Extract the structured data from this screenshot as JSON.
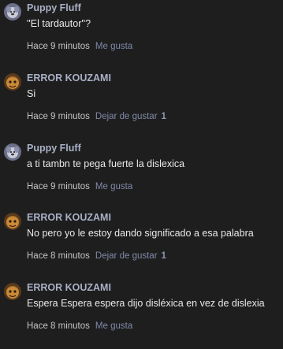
{
  "comments": [
    {
      "author": "Puppy Fluff",
      "avatar_icon": "puppy-avatar-icon",
      "text": "''El tardautor''?",
      "time": "Hace 9 minutos",
      "action": "Me gusta",
      "likes": ""
    },
    {
      "author": "ERROR KOUZAMI",
      "avatar_icon": "kouzami-avatar-icon",
      "text": "Si",
      "time": "Hace 9 minutos",
      "action": "Dejar de gustar",
      "likes": "1"
    },
    {
      "author": "Puppy Fluff",
      "avatar_icon": "puppy-avatar-icon",
      "text": "a ti tambn te pega fuerte la dislexica",
      "time": "Hace 9 minutos",
      "action": "Me gusta",
      "likes": ""
    },
    {
      "author": "ERROR KOUZAMI",
      "avatar_icon": "kouzami-avatar-icon",
      "text": "No pero yo le estoy dando significado a esa palabra",
      "time": "Hace 8 minutos",
      "action": "Dejar de gustar",
      "likes": "1"
    },
    {
      "author": "ERROR KOUZAMI",
      "avatar_icon": "kouzami-avatar-icon",
      "text": "Espera Espera espera dijo disléxica en vez de dislexia",
      "time": "Hace 8 minutos",
      "action": "Me gusta",
      "likes": ""
    }
  ],
  "colors": {
    "background": "#1e1e1e",
    "author": "#a9b0c6",
    "action": "#7f8aa8"
  }
}
